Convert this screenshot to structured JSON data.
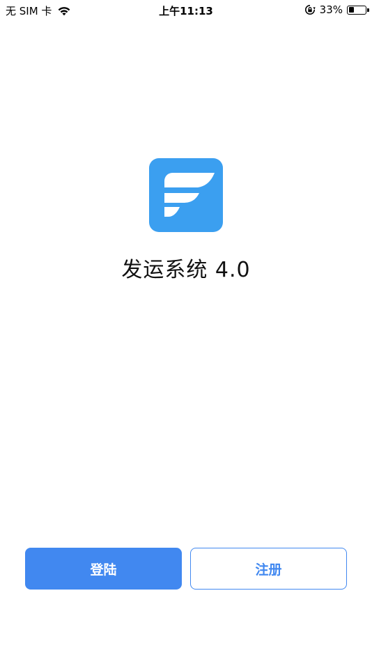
{
  "status_bar": {
    "carrier": "无 SIM 卡",
    "time": "上午11:13",
    "battery_percent_text": "33%",
    "battery_level": 0.33,
    "icons": [
      "wifi-icon",
      "lock-rotation-icon",
      "battery-icon"
    ]
  },
  "app": {
    "logo_icon": "app-logo-icon",
    "name": "发运系统 4.0"
  },
  "actions": {
    "login_label": "登陆",
    "register_label": "注册"
  },
  "colors": {
    "brand_blue": "#4188f0",
    "logo_blue": "#3b9ff0",
    "background": "#ffffff",
    "text": "#111111"
  }
}
